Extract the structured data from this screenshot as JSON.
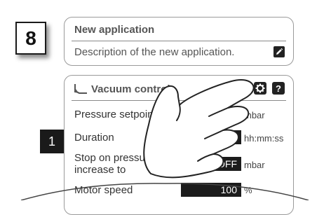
{
  "step_number": "8",
  "app_card": {
    "title": "New application",
    "description": "Description of the new application."
  },
  "control_card": {
    "title": "Vacuum control",
    "params": [
      {
        "label": "Pressure setpoint",
        "value": "",
        "unit": "mbar"
      },
      {
        "label": "Duration",
        "value": "",
        "unit": "hh:mm:ss"
      },
      {
        "label": "Stop on pressure increase to",
        "value": "OFF",
        "unit": "mbar"
      },
      {
        "label": "Motor speed",
        "value": "100",
        "unit": "%"
      }
    ]
  },
  "side_badge": "1",
  "icons": {
    "edit": "pencil-icon",
    "settings": "gear-icon",
    "help": "question-icon",
    "control": "vacuum-curve-icon",
    "gesture": "tapping-hand-icon"
  },
  "help_glyph": "?"
}
